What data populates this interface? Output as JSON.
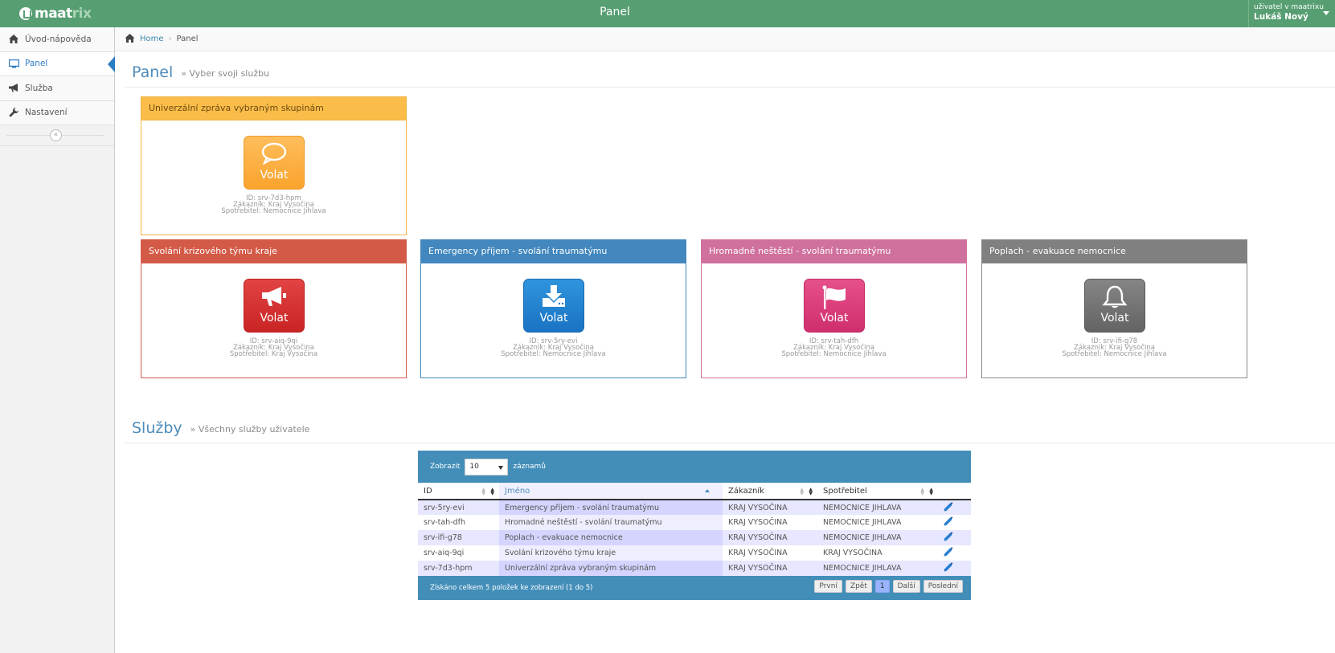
{
  "app": {
    "logo_part1": "maat",
    "logo_part2": "rix",
    "title": "Panel",
    "user_label": "uživatel v maatrixu",
    "user_name": "Lukáš Nový"
  },
  "sidebar": {
    "items": [
      {
        "label": "Úvod-nápověda",
        "icon": "home-icon"
      },
      {
        "label": "Panel",
        "icon": "monitor-icon",
        "active": true
      },
      {
        "label": "Služba",
        "icon": "megaphone-icon"
      },
      {
        "label": "Nastavení",
        "icon": "wrench-icon"
      }
    ],
    "collapse_label": "«"
  },
  "breadcrumb": {
    "home": "Home",
    "current": "Panel"
  },
  "panel_section": {
    "title": "Panel",
    "subtitle": "» Vyber svoji službu"
  },
  "panels": [
    {
      "title": "Univerzální zpráva vybraným skupinám",
      "button": "Volat",
      "icon": "speech-bubble-icon",
      "id": "ID: srv-7d3-hpm",
      "customer": "Zákazník: Kraj Vysočina",
      "consumer": "Spotřebitel: Nemocnice Jihlava",
      "color": "#fbbd4a"
    },
    {
      "title": "Svolání krizového týmu kraje",
      "button": "Volat",
      "icon": "megaphone-icon",
      "id": "ID: srv-aiq-9qi",
      "customer": "Zákazník: Kraj Vysočina",
      "consumer": "Spotřebitel: Kraj Vysočina",
      "color": "#d45a48"
    },
    {
      "title": "Emergency příjem - svolání traumatýmu",
      "button": "Volat",
      "icon": "download-icon",
      "id": "ID: srv-5ry-evi",
      "customer": "Zákazník: Kraj Vysočina",
      "consumer": "Spotřebitel: Nemocnice Jihlava",
      "color": "#4287be"
    },
    {
      "title": "Hromadné neštěstí - svolání traumatýmu",
      "button": "Volat",
      "icon": "flag-icon",
      "id": "ID: srv-tah-dfh",
      "customer": "Zákazník: Kraj Vysočina",
      "consumer": "Spotřebitel: Nemocnice Jihlava",
      "color": "#d0719d"
    },
    {
      "title": "Poplach - evakuace nemocnice",
      "button": "Volat",
      "icon": "bell-icon",
      "id": "ID: srv-ifi-g78",
      "customer": "Zákazník: Kraj Vysočina",
      "consumer": "Spotřebitel: Nemocnice Jihlava",
      "color": "#808080"
    }
  ],
  "services_section": {
    "title": "Služby",
    "subtitle": "» Všechny služby uživatele"
  },
  "table": {
    "show_label": "Zobrazit",
    "page_size": "10",
    "records_label": "záznamů",
    "columns": [
      "ID",
      "Jméno",
      "Zákazník",
      "Spotřebitel"
    ],
    "rows": [
      {
        "id": "srv-5ry-evi",
        "name": "Emergency příjem - svolání traumatýmu",
        "customer": "KRAJ VYSOČINA",
        "consumer": "NEMOCNICE JIHLAVA"
      },
      {
        "id": "srv-tah-dfh",
        "name": "Hromadné neštěstí - svolání traumatýmu",
        "customer": "KRAJ VYSOČINA",
        "consumer": "NEMOCNICE JIHLAVA"
      },
      {
        "id": "srv-ifi-g78",
        "name": "Poplach - evakuace nemocnice",
        "customer": "KRAJ VYSOČINA",
        "consumer": "NEMOCNICE JIHLAVA"
      },
      {
        "id": "srv-aiq-9qi",
        "name": "Svolání krizového týmu kraje",
        "customer": "KRAJ VYSOČINA",
        "consumer": "KRAJ VYSOČINA"
      },
      {
        "id": "srv-7d3-hpm",
        "name": "Univerzální zpráva vybraným skupinám",
        "customer": "KRAJ VYSOČINA",
        "consumer": "NEMOCNICE JIHLAVA"
      }
    ],
    "footer": "Získáno celkem 5 položek ke zobrazení (1 do 5)",
    "pager": {
      "first": "První",
      "prev": "Zpět",
      "page": "1",
      "next": "Další",
      "last": "Poslední"
    }
  },
  "colors": {
    "topbar": "#579f72",
    "accent": "#4e8cba",
    "table_header": "#438eb9"
  }
}
